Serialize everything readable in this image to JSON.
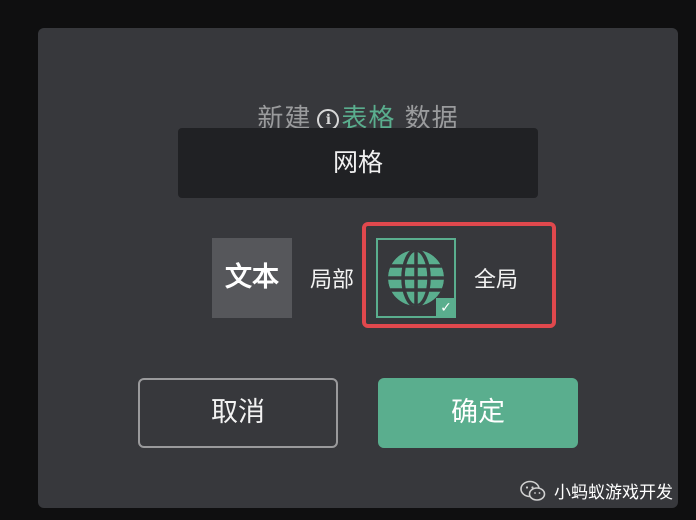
{
  "dialog": {
    "title": {
      "prefix": "新建",
      "info_icon": "i",
      "accent": "表格",
      "suffix": " 数据"
    },
    "name_field": {
      "value": "网格"
    },
    "options": {
      "local": {
        "icon_text": "文本",
        "label": "局部",
        "selected": false
      },
      "global": {
        "icon": "globe-icon",
        "label": "全局",
        "selected": true,
        "check": "✓"
      }
    },
    "buttons": {
      "cancel": "取消",
      "confirm": "确定"
    }
  },
  "watermark": {
    "icon": "wechat-icon",
    "text": "小蚂蚁游戏开发"
  },
  "colors": {
    "accent": "#5aae8e",
    "highlight": "#e0484d",
    "dialog_bg": "#37383c",
    "field_bg": "#202124"
  }
}
